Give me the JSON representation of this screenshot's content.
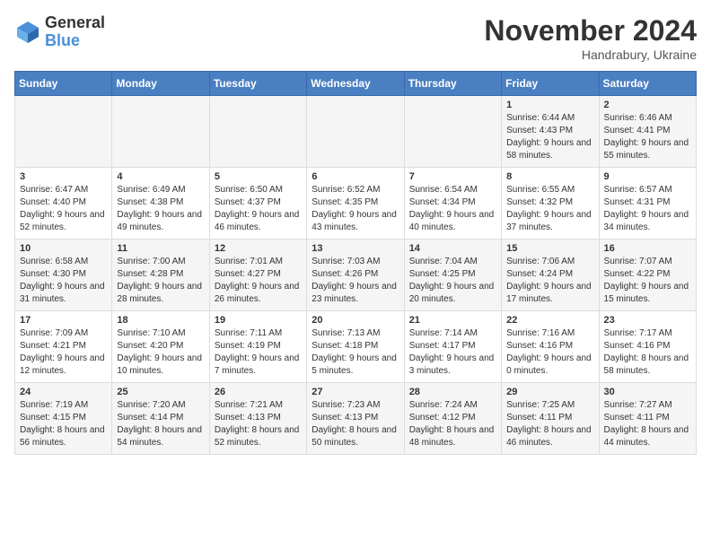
{
  "header": {
    "logo_general": "General",
    "logo_blue": "Blue",
    "month_title": "November 2024",
    "location": "Handrabury, Ukraine"
  },
  "days_of_week": [
    "Sunday",
    "Monday",
    "Tuesday",
    "Wednesday",
    "Thursday",
    "Friday",
    "Saturday"
  ],
  "weeks": [
    [
      {
        "day": "",
        "info": ""
      },
      {
        "day": "",
        "info": ""
      },
      {
        "day": "",
        "info": ""
      },
      {
        "day": "",
        "info": ""
      },
      {
        "day": "",
        "info": ""
      },
      {
        "day": "1",
        "info": "Sunrise: 6:44 AM\nSunset: 4:43 PM\nDaylight: 9 hours and 58 minutes."
      },
      {
        "day": "2",
        "info": "Sunrise: 6:46 AM\nSunset: 4:41 PM\nDaylight: 9 hours and 55 minutes."
      }
    ],
    [
      {
        "day": "3",
        "info": "Sunrise: 6:47 AM\nSunset: 4:40 PM\nDaylight: 9 hours and 52 minutes."
      },
      {
        "day": "4",
        "info": "Sunrise: 6:49 AM\nSunset: 4:38 PM\nDaylight: 9 hours and 49 minutes."
      },
      {
        "day": "5",
        "info": "Sunrise: 6:50 AM\nSunset: 4:37 PM\nDaylight: 9 hours and 46 minutes."
      },
      {
        "day": "6",
        "info": "Sunrise: 6:52 AM\nSunset: 4:35 PM\nDaylight: 9 hours and 43 minutes."
      },
      {
        "day": "7",
        "info": "Sunrise: 6:54 AM\nSunset: 4:34 PM\nDaylight: 9 hours and 40 minutes."
      },
      {
        "day": "8",
        "info": "Sunrise: 6:55 AM\nSunset: 4:32 PM\nDaylight: 9 hours and 37 minutes."
      },
      {
        "day": "9",
        "info": "Sunrise: 6:57 AM\nSunset: 4:31 PM\nDaylight: 9 hours and 34 minutes."
      }
    ],
    [
      {
        "day": "10",
        "info": "Sunrise: 6:58 AM\nSunset: 4:30 PM\nDaylight: 9 hours and 31 minutes."
      },
      {
        "day": "11",
        "info": "Sunrise: 7:00 AM\nSunset: 4:28 PM\nDaylight: 9 hours and 28 minutes."
      },
      {
        "day": "12",
        "info": "Sunrise: 7:01 AM\nSunset: 4:27 PM\nDaylight: 9 hours and 26 minutes."
      },
      {
        "day": "13",
        "info": "Sunrise: 7:03 AM\nSunset: 4:26 PM\nDaylight: 9 hours and 23 minutes."
      },
      {
        "day": "14",
        "info": "Sunrise: 7:04 AM\nSunset: 4:25 PM\nDaylight: 9 hours and 20 minutes."
      },
      {
        "day": "15",
        "info": "Sunrise: 7:06 AM\nSunset: 4:24 PM\nDaylight: 9 hours and 17 minutes."
      },
      {
        "day": "16",
        "info": "Sunrise: 7:07 AM\nSunset: 4:22 PM\nDaylight: 9 hours and 15 minutes."
      }
    ],
    [
      {
        "day": "17",
        "info": "Sunrise: 7:09 AM\nSunset: 4:21 PM\nDaylight: 9 hours and 12 minutes."
      },
      {
        "day": "18",
        "info": "Sunrise: 7:10 AM\nSunset: 4:20 PM\nDaylight: 9 hours and 10 minutes."
      },
      {
        "day": "19",
        "info": "Sunrise: 7:11 AM\nSunset: 4:19 PM\nDaylight: 9 hours and 7 minutes."
      },
      {
        "day": "20",
        "info": "Sunrise: 7:13 AM\nSunset: 4:18 PM\nDaylight: 9 hours and 5 minutes."
      },
      {
        "day": "21",
        "info": "Sunrise: 7:14 AM\nSunset: 4:17 PM\nDaylight: 9 hours and 3 minutes."
      },
      {
        "day": "22",
        "info": "Sunrise: 7:16 AM\nSunset: 4:16 PM\nDaylight: 9 hours and 0 minutes."
      },
      {
        "day": "23",
        "info": "Sunrise: 7:17 AM\nSunset: 4:16 PM\nDaylight: 8 hours and 58 minutes."
      }
    ],
    [
      {
        "day": "24",
        "info": "Sunrise: 7:19 AM\nSunset: 4:15 PM\nDaylight: 8 hours and 56 minutes."
      },
      {
        "day": "25",
        "info": "Sunrise: 7:20 AM\nSunset: 4:14 PM\nDaylight: 8 hours and 54 minutes."
      },
      {
        "day": "26",
        "info": "Sunrise: 7:21 AM\nSunset: 4:13 PM\nDaylight: 8 hours and 52 minutes."
      },
      {
        "day": "27",
        "info": "Sunrise: 7:23 AM\nSunset: 4:13 PM\nDaylight: 8 hours and 50 minutes."
      },
      {
        "day": "28",
        "info": "Sunrise: 7:24 AM\nSunset: 4:12 PM\nDaylight: 8 hours and 48 minutes."
      },
      {
        "day": "29",
        "info": "Sunrise: 7:25 AM\nSunset: 4:11 PM\nDaylight: 8 hours and 46 minutes."
      },
      {
        "day": "30",
        "info": "Sunrise: 7:27 AM\nSunset: 4:11 PM\nDaylight: 8 hours and 44 minutes."
      }
    ]
  ]
}
